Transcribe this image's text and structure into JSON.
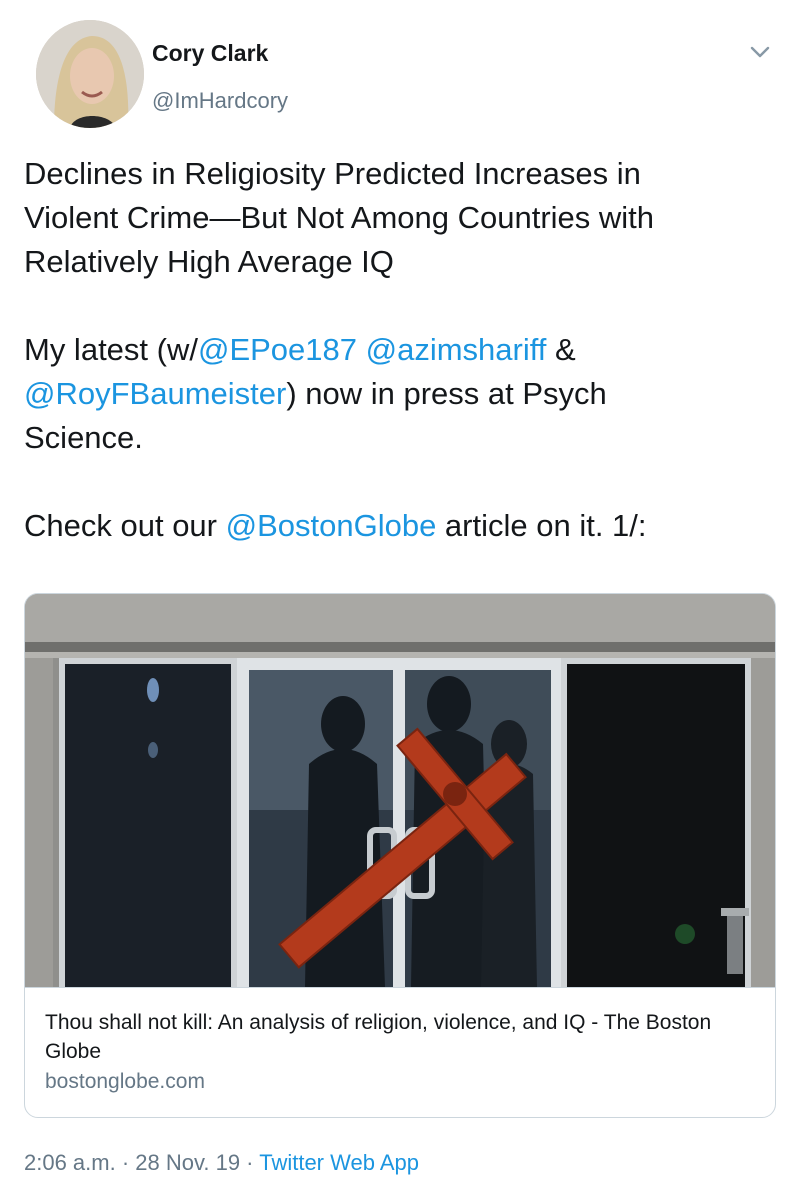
{
  "author": {
    "name": "Cory Clark",
    "handle": "@ImHardcory"
  },
  "tweet": {
    "line1": "Declines in Religiosity Predicted Increases in",
    "line2": "Violent Crime—But Not Among Countries with",
    "line3": "Relatively High Average IQ",
    "p2_a": "My latest (w/",
    "mention1": "@EPoe187",
    "p2_b": " ",
    "mention2": "@azimshariff",
    "p2_c": " &",
    "mention3": "@RoyFBaumeister",
    "p2_d": ") now in press at Psych",
    "p2_e": "Science.",
    "p3_a": "Check out our ",
    "mention4": "@BostonGlobe",
    "p3_b": " article on it. 1/:"
  },
  "card": {
    "title": "Thou shall not kill: An analysis of religion, violence, and IQ - The Boston Globe",
    "domain": "bostonglobe.com"
  },
  "meta": {
    "time": "2:06 a.m.",
    "sep1": " · ",
    "date": "28 Nov. 19",
    "sep2": " · ",
    "app": "Twitter Web App"
  },
  "colors": {
    "link": "#1b95e0",
    "secondary": "#657786",
    "text": "#14171a",
    "cross": "#b33a1c"
  },
  "icons": {
    "chevron": "chevron-down-icon"
  }
}
